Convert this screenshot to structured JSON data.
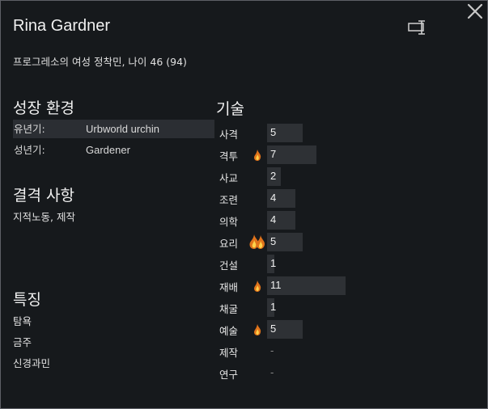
{
  "pawn": {
    "name": "Rina Gardner",
    "description": "프로그레소의 여성 정착민, 나이 46 (94)"
  },
  "backstory": {
    "title": "성장 환경",
    "childhood_label": "유년기:",
    "childhood_value": "Urbworld urchin",
    "adulthood_label": "성년기:",
    "adulthood_value": "Gardener"
  },
  "incapable": {
    "title": "결격 사항",
    "text": "지적노동, 제작"
  },
  "traits": {
    "title": "특징",
    "items": [
      "탐욕",
      "금주",
      "신경과민"
    ]
  },
  "skills": {
    "title": "기술",
    "rows": [
      {
        "name": "사격",
        "level": "5",
        "passion": "none",
        "fill": 0.45
      },
      {
        "name": "격투",
        "level": "7",
        "passion": "minor",
        "fill": 0.63
      },
      {
        "name": "사교",
        "level": "2",
        "passion": "none",
        "fill": 0.18
      },
      {
        "name": "조련",
        "level": "4",
        "passion": "none",
        "fill": 0.36
      },
      {
        "name": "의학",
        "level": "4",
        "passion": "none",
        "fill": 0.36
      },
      {
        "name": "요리",
        "level": "5",
        "passion": "major",
        "fill": 0.45
      },
      {
        "name": "건설",
        "level": "1",
        "passion": "none",
        "fill": 0.09
      },
      {
        "name": "재배",
        "level": "11",
        "passion": "minor",
        "fill": 1.0
      },
      {
        "name": "채굴",
        "level": "1",
        "passion": "none",
        "fill": 0.09
      },
      {
        "name": "예술",
        "level": "5",
        "passion": "minor",
        "fill": 0.45
      },
      {
        "name": "제작",
        "level": "-",
        "passion": "none",
        "fill": 0
      },
      {
        "name": "연구",
        "level": "-",
        "passion": "none",
        "fill": 0
      }
    ]
  },
  "icons": {
    "close": "close-icon",
    "rename": "rename-icon",
    "passion_minor": "minor-passion-flame-icon",
    "passion_major": "major-passion-flame-icon"
  },
  "colors": {
    "flame_outer": "#e0731b",
    "flame_inner": "#ffd24a"
  }
}
